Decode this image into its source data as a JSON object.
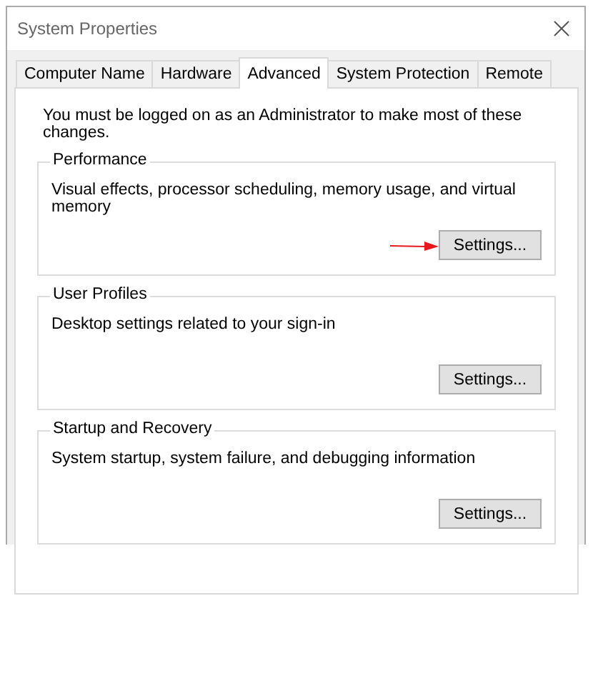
{
  "window": {
    "title": "System Properties"
  },
  "tabs": [
    {
      "label": "Computer Name",
      "selected": false
    },
    {
      "label": "Hardware",
      "selected": false
    },
    {
      "label": "Advanced",
      "selected": true
    },
    {
      "label": "System Protection",
      "selected": false
    },
    {
      "label": "Remote",
      "selected": false
    }
  ],
  "notice": "You must be logged on as an Administrator to make most of these changes.",
  "groups": [
    {
      "title": "Performance",
      "description": "Visual effects, processor scheduling, memory usage, and virtual memory",
      "button": "Settings...",
      "pointed_at": true
    },
    {
      "title": "User Profiles",
      "description": "Desktop settings related to your sign-in",
      "button": "Settings...",
      "pointed_at": false
    },
    {
      "title": "Startup and Recovery",
      "description": "System startup, system failure, and debugging information",
      "button": "Settings...",
      "pointed_at": false
    }
  ]
}
